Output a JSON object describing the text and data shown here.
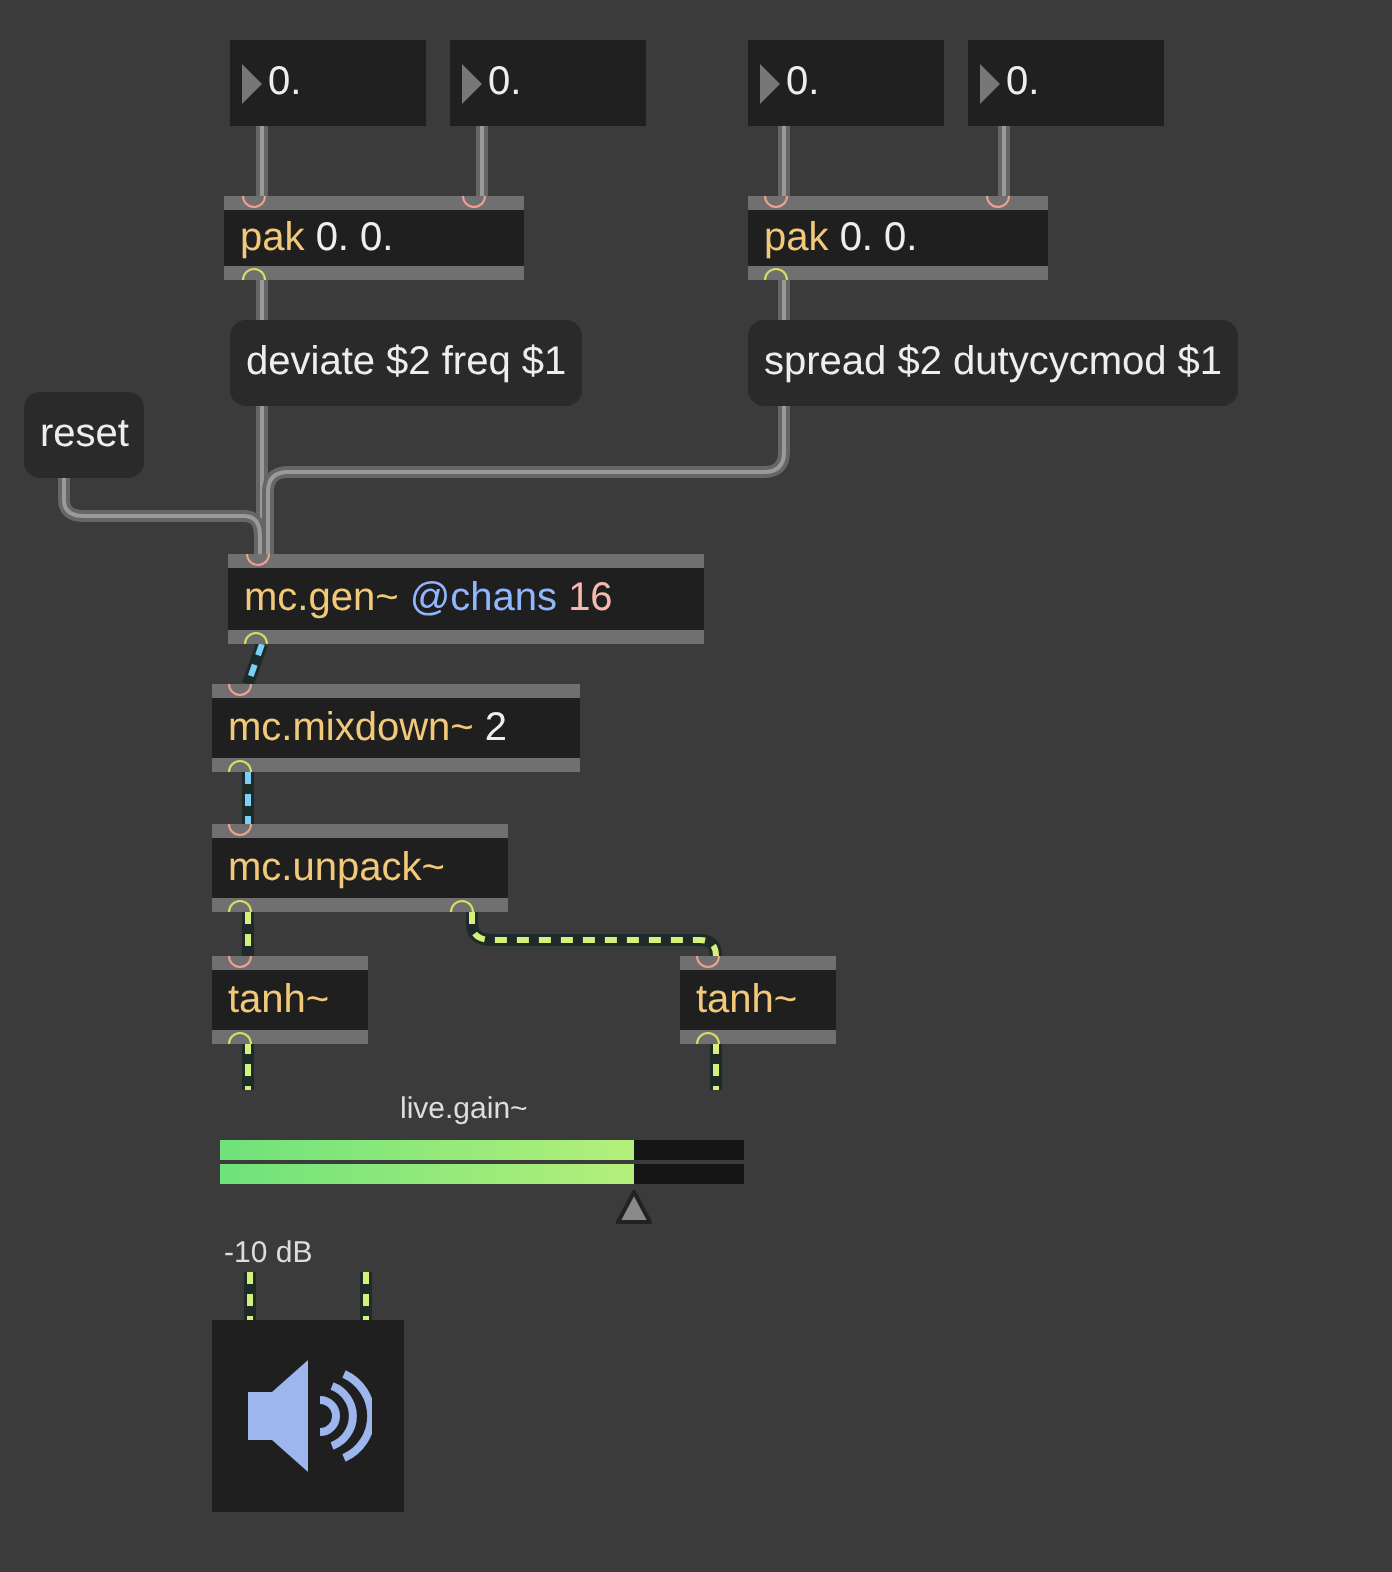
{
  "number_boxes": [
    {
      "value": "0."
    },
    {
      "value": "0."
    },
    {
      "value": "0."
    },
    {
      "value": "0."
    }
  ],
  "objects": [
    {
      "parts": [
        {
          "text": "pak",
          "kind": "class"
        },
        {
          "text": "0. 0.",
          "kind": "argument"
        }
      ]
    },
    {
      "parts": [
        {
          "text": "pak",
          "kind": "class"
        },
        {
          "text": "0. 0.",
          "kind": "argument"
        }
      ]
    },
    {
      "parts": [
        {
          "text": "mc.gen~",
          "kind": "class"
        },
        {
          "text": "@chans",
          "kind": "attribute"
        },
        {
          "text": "16",
          "kind": "setting"
        }
      ]
    },
    {
      "parts": [
        {
          "text": "mc.mixdown~",
          "kind": "class"
        },
        {
          "text": "2",
          "kind": "argument"
        }
      ]
    },
    {
      "parts": [
        {
          "text": "mc.unpack~",
          "kind": "class"
        }
      ]
    },
    {
      "parts": [
        {
          "text": "tanh~",
          "kind": "class"
        }
      ]
    },
    {
      "parts": [
        {
          "text": "tanh~",
          "kind": "class"
        }
      ]
    }
  ],
  "messages": [
    {
      "text": "deviate $2 freq $1"
    },
    {
      "text": "spread $2 dutycycmod $1"
    },
    {
      "text": "reset"
    }
  ],
  "live_gain": {
    "label": "live.gain~",
    "level": 0.79,
    "reading": "-10 dB"
  }
}
